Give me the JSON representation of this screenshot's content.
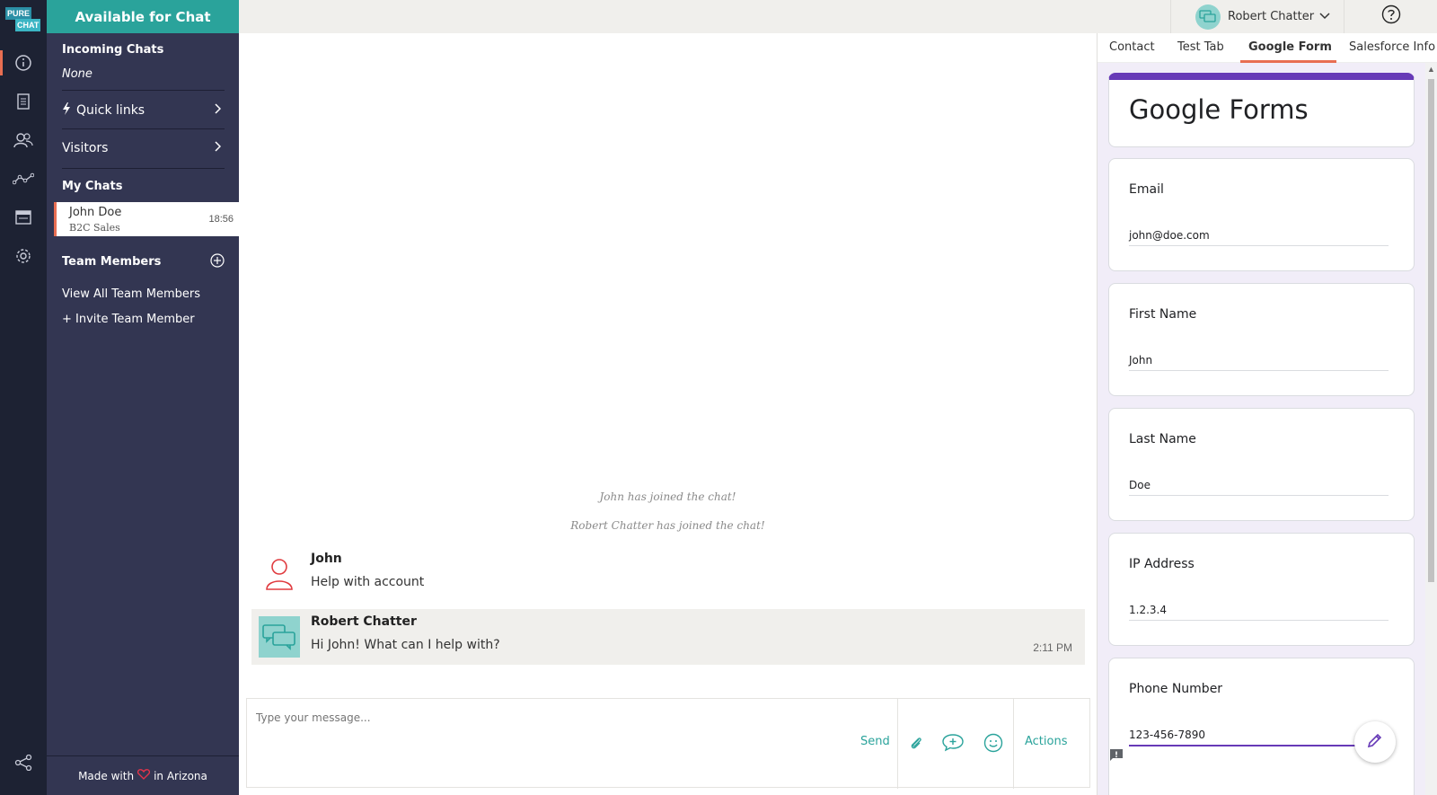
{
  "app": {
    "logo_top": "PURE",
    "logo_bottom": "CHAT"
  },
  "rail": {
    "items": [
      "dashboard-icon",
      "transcripts-icon",
      "contacts-icon",
      "analytics-icon",
      "widgets-icon",
      "settings-icon",
      "share-icon"
    ]
  },
  "status": {
    "label": "Available for Chat"
  },
  "sidebar": {
    "incoming_title": "Incoming Chats",
    "incoming_value": "None",
    "quick_links": "Quick links",
    "visitors": "Visitors",
    "my_chats_title": "My Chats",
    "chat": {
      "name": "John Doe",
      "group": "B2C Sales",
      "time": "18:56"
    },
    "team_title": "Team Members",
    "view_all": "View All Team Members",
    "invite": "+ Invite Team Member",
    "made_with_prefix": "Made with",
    "made_with_suffix": "in Arizona"
  },
  "topbar": {
    "user_name": "Robert Chatter"
  },
  "chat": {
    "system_messages": [
      "John has joined the chat!",
      "Robert Chatter has joined the chat!"
    ],
    "messages": [
      {
        "author": "John",
        "text": "Help with account",
        "time": ""
      },
      {
        "author": "Robert Chatter",
        "text": "Hi John! What can I help with?",
        "time": "2:11 PM"
      }
    ],
    "composer": {
      "placeholder": "Type your message...",
      "send": "Send",
      "actions": "Actions"
    }
  },
  "right_panel": {
    "tabs": [
      "Contact",
      "Test Tab",
      "Google Form",
      "Salesforce Info"
    ],
    "active_tab": "Google Form",
    "form_title": "Google Forms",
    "fields": [
      {
        "label": "Email",
        "value": "john@doe.com"
      },
      {
        "label": "First Name",
        "value": "John"
      },
      {
        "label": "Last Name",
        "value": "Doe"
      },
      {
        "label": "IP Address",
        "value": "1.2.3.4"
      },
      {
        "label": "Phone Number",
        "value": "123-456-7890"
      }
    ]
  },
  "colors": {
    "accent": "#2aa39b",
    "sidebar": "#333652",
    "rail": "#1d2233",
    "highlight": "#e86e52",
    "form_purple": "#673ab7"
  }
}
